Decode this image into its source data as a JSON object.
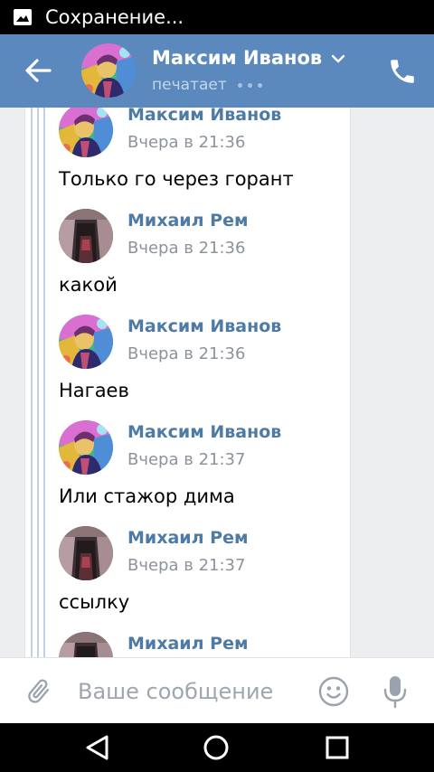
{
  "status_bar": {
    "text": "Сохранение...",
    "icon": "image-icon"
  },
  "header": {
    "contact_name": "Максим Иванов",
    "status": "печатает",
    "accent_color": "#5b88bd",
    "icons": [
      "back-arrow-icon",
      "chevron-down-icon",
      "phone-icon"
    ]
  },
  "messages": [
    {
      "author": "Максим Иванов",
      "time": "Вчера в 21:36",
      "text": "Только го через горант",
      "avatar": "maksim"
    },
    {
      "author": "Михаил Рем",
      "time": "Вчера в 21:36",
      "text": "какой",
      "avatar": "mikhail"
    },
    {
      "author": "Максим Иванов",
      "time": "Вчера в 21:36",
      "text": "Нагаев",
      "avatar": "maksim"
    },
    {
      "author": "Максим Иванов",
      "time": "Вчера в 21:37",
      "text": "Или стажор дима",
      "avatar": "maksim"
    },
    {
      "author": "Михаил Рем",
      "time": "Вчера в 21:37",
      "text": "ссылку",
      "avatar": "mikhail"
    },
    {
      "author": "Михаил Рем",
      "time": "",
      "text": "",
      "avatar": "mikhail"
    }
  ],
  "composer": {
    "placeholder": "Ваше сообщение",
    "icons": [
      "paperclip-icon",
      "emoji-icon",
      "microphone-icon"
    ]
  },
  "nav_bar": {
    "icons": [
      "nav-back-icon",
      "nav-home-icon",
      "nav-recents-icon"
    ]
  }
}
